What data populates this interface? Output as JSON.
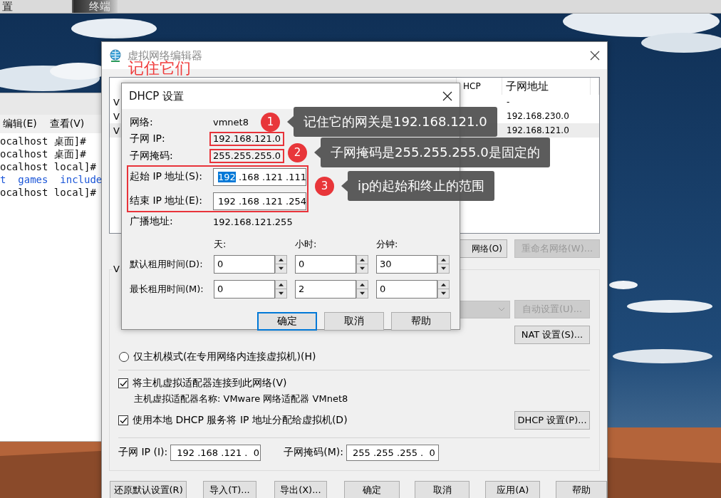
{
  "taskbar": {
    "items": [
      {
        "label": "置",
        "selected": false
      },
      {
        "label": "终端",
        "selected": true
      }
    ]
  },
  "terminal": {
    "menu": [
      "编辑(E)",
      "查看(V)"
    ],
    "lines": [
      {
        "kind": "prompt",
        "text": "ocalhost 桌面]#"
      },
      {
        "kind": "prompt",
        "text": "ocalhost 桌面]#"
      },
      {
        "kind": "prompt",
        "text": "ocalhost local]#"
      },
      {
        "kind": "listing",
        "text": "t  games  include"
      },
      {
        "kind": "prompt",
        "text": "ocalhost local]#"
      }
    ]
  },
  "editor": {
    "title": "虚拟网络编辑器",
    "table": {
      "columns": [
        "HCP",
        "子网地址"
      ],
      "rows": [
        {
          "name": "V",
          "subnet": "-",
          "selected": false
        },
        {
          "name": "V",
          "subnet": "192.168.230.0",
          "selected": false
        },
        {
          "name": "V",
          "subnet": "192.168.121.0",
          "selected": true
        }
      ]
    },
    "table_buttons": [
      {
        "label": "网络(O)",
        "disabled": false
      },
      {
        "label": "重命名网络(W)...",
        "disabled": true
      }
    ],
    "info": {
      "legend": "V",
      "auto_button": {
        "label": "自动设置(U)...",
        "disabled": true
      },
      "nat_button": {
        "label": "NAT 设置(S)...",
        "disabled": false
      },
      "host_only": {
        "label": "仅主机模式(在专用网络内连接虚拟机)(H)",
        "selected": false
      },
      "connect_adapter": {
        "label": "将主机虚拟适配器连接到此网络(V)",
        "checked": true
      },
      "adapter_name": "主机虚拟适配器名称: VMware 网络适配器 VMnet8",
      "use_dhcp": {
        "label": "使用本地 DHCP 服务将 IP 地址分配给虚拟机(D)",
        "checked": true
      },
      "dhcp_button": "DHCP 设置(P)...",
      "subnet_ip": {
        "label": "子网 IP (I):",
        "value": "192 .168 .121 .  0"
      },
      "subnet_mask": {
        "label": "子网掩码(M):",
        "value": "255 .255 .255 .  0"
      }
    },
    "buttons": [
      "还原默认设置(R)",
      "导入(T)...",
      "导出(X)...",
      "确定",
      "取消",
      "应用(A)",
      "帮助"
    ]
  },
  "dhcp_dialog": {
    "title": "DHCP 设置",
    "info": [
      {
        "label": "网络:",
        "value": "vmnet8",
        "highlighted": false
      },
      {
        "label": "子网 IP:",
        "value": "192.168.121.0",
        "highlighted": true
      },
      {
        "label": "子网掩码:",
        "value": "255.255.255.0",
        "highlighted": true
      }
    ],
    "start_ip": {
      "label": "起始 IP 地址(S):",
      "segments": [
        {
          "text": "192",
          "selected": true
        },
        {
          "text": " .168",
          "selected": false
        },
        {
          "text": " .121",
          "selected": false
        },
        {
          "text": " .111",
          "selected": false
        }
      ]
    },
    "end_ip": {
      "label": "结束 IP 地址(E):",
      "segments": [
        {
          "text": "192",
          "selected": false
        },
        {
          "text": " .168",
          "selected": false
        },
        {
          "text": " .121",
          "selected": false
        },
        {
          "text": " .254",
          "selected": false
        }
      ]
    },
    "broadcast": {
      "label": "广播地址:",
      "value": "192.168.121.255"
    },
    "lease_columns": [
      "天:",
      "小时:",
      "分钟:"
    ],
    "lease_rows": [
      {
        "label": "默认租用时间(D):",
        "values": [
          "0",
          "0",
          "30"
        ]
      },
      {
        "label": "最长租用时间(M):",
        "values": [
          "0",
          "2",
          "0"
        ]
      }
    ],
    "buttons": [
      {
        "label": "确定",
        "focused": true
      },
      {
        "label": "取消",
        "focused": false
      },
      {
        "label": "帮助",
        "focused": false
      }
    ]
  },
  "annotations": {
    "note": "记住它们",
    "callouts": [
      {
        "number": "1",
        "text": "记住它的网关是192.168.121.0"
      },
      {
        "number": "2",
        "text": "子网掩码是255.255.255.0是固定的"
      },
      {
        "number": "3",
        "text": "ip的起始和终止的范围"
      }
    ]
  }
}
